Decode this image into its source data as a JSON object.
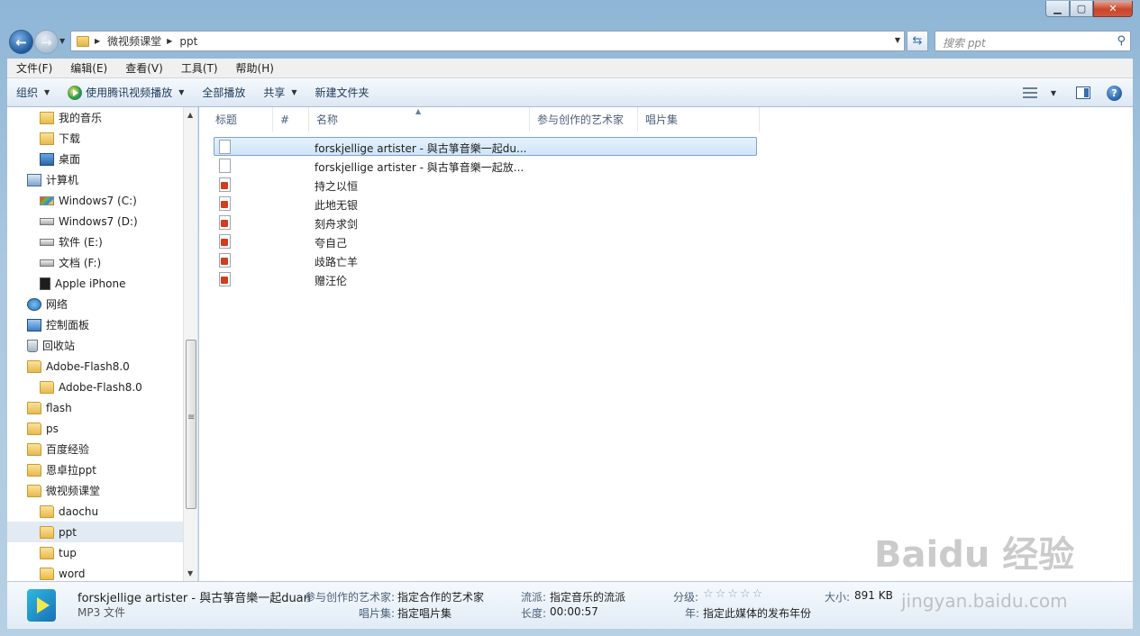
{
  "window": {
    "controls": {
      "minimize": "▁",
      "maximize": "▢",
      "close": "✕"
    }
  },
  "address": {
    "crumbs": [
      "微视频课堂",
      "ppt"
    ],
    "search_placeholder": "搜索 ppt"
  },
  "menubar": {
    "items": [
      "文件(F)",
      "编辑(E)",
      "查看(V)",
      "工具(T)",
      "帮助(H)"
    ]
  },
  "cmdbar": {
    "organize": "组织",
    "play_with": "使用腾讯视频播放",
    "play_all": "全部播放",
    "share": "共享",
    "new_folder": "新建文件夹"
  },
  "navpane": {
    "items": [
      {
        "label": "我的音乐",
        "icon": "music-folder-icon"
      },
      {
        "label": "下载",
        "icon": "downloads-folder-icon"
      },
      {
        "label": "桌面",
        "icon": "desktop-icon"
      },
      {
        "label": "计算机",
        "icon": "computer-icon"
      },
      {
        "label": "Windows7 (C:)",
        "icon": "system-drive-icon"
      },
      {
        "label": "Windows7 (D:)",
        "icon": "drive-icon"
      },
      {
        "label": "软件 (E:)",
        "icon": "drive-icon"
      },
      {
        "label": "文档 (F:)",
        "icon": "drive-icon"
      },
      {
        "label": "Apple iPhone",
        "icon": "iphone-icon"
      },
      {
        "label": "网络",
        "icon": "network-icon"
      },
      {
        "label": "控制面板",
        "icon": "control-panel-icon"
      },
      {
        "label": "回收站",
        "icon": "recycle-bin-icon"
      },
      {
        "label": "Adobe-Flash8.0",
        "icon": "folder-icon"
      },
      {
        "label": "Adobe-Flash8.0",
        "icon": "folder-icon"
      },
      {
        "label": "flash",
        "icon": "folder-icon"
      },
      {
        "label": "ps",
        "icon": "folder-icon"
      },
      {
        "label": "百度经验",
        "icon": "folder-icon"
      },
      {
        "label": "恩卓拉ppt",
        "icon": "folder-icon"
      },
      {
        "label": "微视频课堂",
        "icon": "folder-icon"
      },
      {
        "label": "daochu",
        "icon": "folder-icon"
      },
      {
        "label": "ppt",
        "icon": "folder-icon",
        "selected": true
      },
      {
        "label": "tup",
        "icon": "folder-icon"
      },
      {
        "label": "word",
        "icon": "folder-icon"
      }
    ]
  },
  "columns": {
    "title": "标题",
    "number": "#",
    "name": "名称",
    "artists": "参与创作的艺术家",
    "album": "唱片集"
  },
  "files": [
    {
      "name": "forskjellige artister - 與古箏音樂一起du...",
      "type": "blank",
      "selected": true
    },
    {
      "name": "forskjellige artister - 與古箏音樂一起放...",
      "type": "blank"
    },
    {
      "name": "持之以恒",
      "type": "ppt"
    },
    {
      "name": "此地无银",
      "type": "ppt"
    },
    {
      "name": "刻舟求剑",
      "type": "ppt"
    },
    {
      "name": "夸自己",
      "type": "ppt"
    },
    {
      "name": "歧路亡羊",
      "type": "ppt"
    },
    {
      "name": "赠汪伦",
      "type": "ppt"
    }
  ],
  "details": {
    "filename": "forskjellige artister - 與古箏音樂一起duan",
    "filetype": "MP3 文件",
    "artists_label": "参与创作的艺术家:",
    "artists_value": "指定合作的艺术家",
    "album_label": "唱片集:",
    "album_value": "指定唱片集",
    "genre_label": "流派:",
    "genre_value": "指定音乐的流派",
    "length_label": "长度:",
    "length_value": "00:00:57",
    "rating_label": "分级:",
    "rating_stars": "☆☆☆☆☆",
    "year_label": "年:",
    "year_value": "指定此媒体的发布年份",
    "size_label": "大小:",
    "size_value": "891 KB"
  },
  "watermark": {
    "logo": "Baidu 经验",
    "url": "jingyan.baidu.com"
  }
}
